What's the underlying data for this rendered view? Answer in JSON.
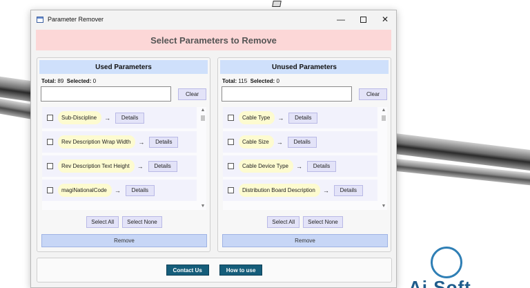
{
  "window": {
    "title": "Parameter Remover",
    "controls": {
      "minimize": "—",
      "close": "✕"
    }
  },
  "banner": "Select Parameters to Remove",
  "panels": {
    "used": {
      "title": "Used Parameters",
      "total_label": "Total:",
      "total": "89",
      "selected_label": "Selected:",
      "selected": "0",
      "search_value": "",
      "clear_label": "Clear",
      "items": [
        {
          "name": "Sub-Discipline",
          "details": "Details"
        },
        {
          "name": "Rev Description Wrap Width",
          "details": "Details"
        },
        {
          "name": "Rev Description Text Height",
          "details": "Details"
        },
        {
          "name": "magiNationalCode",
          "details": "Details"
        }
      ],
      "select_all": "Select All",
      "select_none": "Select None",
      "remove": "Remove"
    },
    "unused": {
      "title": "Unused Parameters",
      "total_label": "Total:",
      "total": "115",
      "selected_label": "Selected:",
      "selected": "0",
      "search_value": "",
      "clear_label": "Clear",
      "items": [
        {
          "name": "Cable Type",
          "details": "Details"
        },
        {
          "name": "Cable Size",
          "details": "Details"
        },
        {
          "name": "Cable Device Type",
          "details": "Details"
        },
        {
          "name": "Distribution Board Description",
          "details": "Details"
        }
      ],
      "select_all": "Select All",
      "select_none": "Select None",
      "remove": "Remove"
    }
  },
  "arrow_glyph": "→",
  "footer": {
    "contact": "Contact Us",
    "how_to": "How to use"
  },
  "logo_text": "Ai Soft"
}
